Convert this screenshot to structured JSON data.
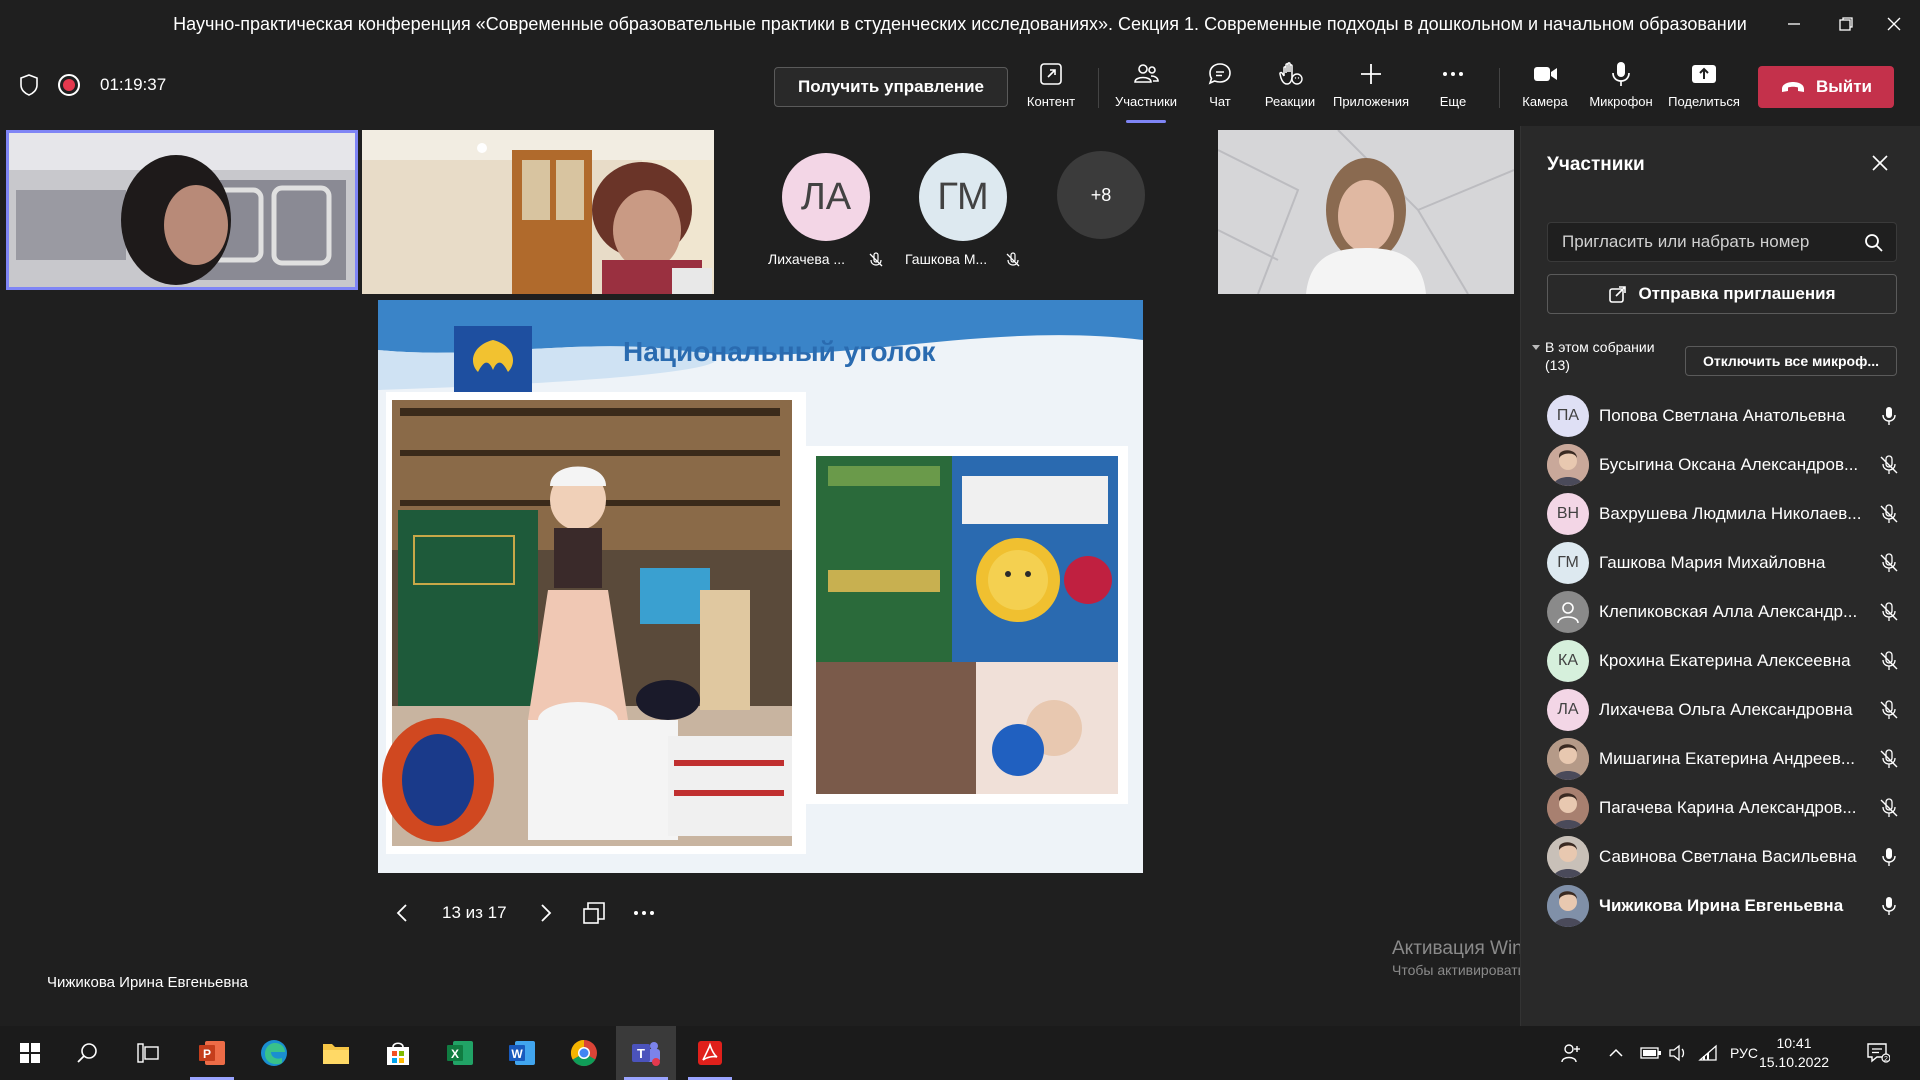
{
  "window": {
    "title": "Научно-практическая конференция «Современные образовательные практики в студенческих исследованиях». Секция 1. Современные подходы в дошкольном и начальном образовании"
  },
  "toolbar": {
    "timer": "01:19:37",
    "take_control": "Получить управление",
    "items": {
      "content": "Контент",
      "participants": "Участники",
      "chat": "Чат",
      "reactions": "Реакции",
      "apps": "Приложения",
      "more": "Еще",
      "camera": "Камера",
      "mic": "Микрофон",
      "share": "Поделиться"
    },
    "leave": "Выйти"
  },
  "gallery": {
    "avatars": [
      {
        "initials": "ЛА",
        "name": "Лихачева ...",
        "color": "#f3d6e6"
      },
      {
        "initials": "ГМ",
        "name": "Гашкова М...",
        "color": "#dde9f0"
      }
    ],
    "overflow": "+8"
  },
  "slide": {
    "title": "Национальный уголок",
    "counter": "13 из 17"
  },
  "presenter": "Чижикова Ирина Евгеньевна",
  "watermark": {
    "line1": "Активация Windows",
    "line2": "Чтобы активировать Windows, перейдите в раздел \"Параметры\"."
  },
  "panel": {
    "title": "Участники",
    "invite_placeholder": "Пригласить или набрать номер",
    "send_invite": "Отправка приглашения",
    "section_label": "В этом собрании",
    "section_count": "(13)",
    "mute_all": "Отключить все микроф...",
    "participants": [
      {
        "initials": "ПА",
        "name": "Попова Светлана Анатольевна",
        "avatar": "#dfe0f5",
        "mic": "on",
        "photo": false
      },
      {
        "initials": "",
        "name": "Бусыгина Оксана Александров...",
        "avatar": "#c9a89a",
        "mic": "off",
        "photo": true
      },
      {
        "initials": "ВН",
        "name": "Вахрушева Людмила Николаев...",
        "avatar": "#f3d6e6",
        "mic": "off",
        "photo": false
      },
      {
        "initials": "ГМ",
        "name": "Гашкова Мария Михайловна",
        "avatar": "#dde9f0",
        "mic": "off",
        "photo": false
      },
      {
        "initials": "",
        "name": "Клепиковская Алла Александр...",
        "avatar": "#8a8a8a",
        "mic": "off",
        "photo": false
      },
      {
        "initials": "КА",
        "name": "Крохина Екатерина Алексеевна",
        "avatar": "#d6f0dc",
        "mic": "off",
        "photo": false
      },
      {
        "initials": "ЛА",
        "name": "Лихачева Ольга Александровна",
        "avatar": "#f3d6e6",
        "mic": "off",
        "photo": false
      },
      {
        "initials": "",
        "name": "Мишагина Екатерина Андреев...",
        "avatar": "#b59a88",
        "mic": "off",
        "photo": true
      },
      {
        "initials": "",
        "name": "Пагачева Карина Александров...",
        "avatar": "#a88070",
        "mic": "off",
        "photo": true
      },
      {
        "initials": "",
        "name": "Савинова Светлана Васильевна",
        "avatar": "#c8c0b8",
        "mic": "on",
        "photo": true
      },
      {
        "initials": "",
        "name": "Чижикова Ирина Евгеньевна",
        "avatar": "#8090a8",
        "mic": "on",
        "photo": true
      }
    ]
  },
  "taskbar": {
    "lang": "РУС",
    "time": "10:41",
    "date": "15.10.2022"
  }
}
